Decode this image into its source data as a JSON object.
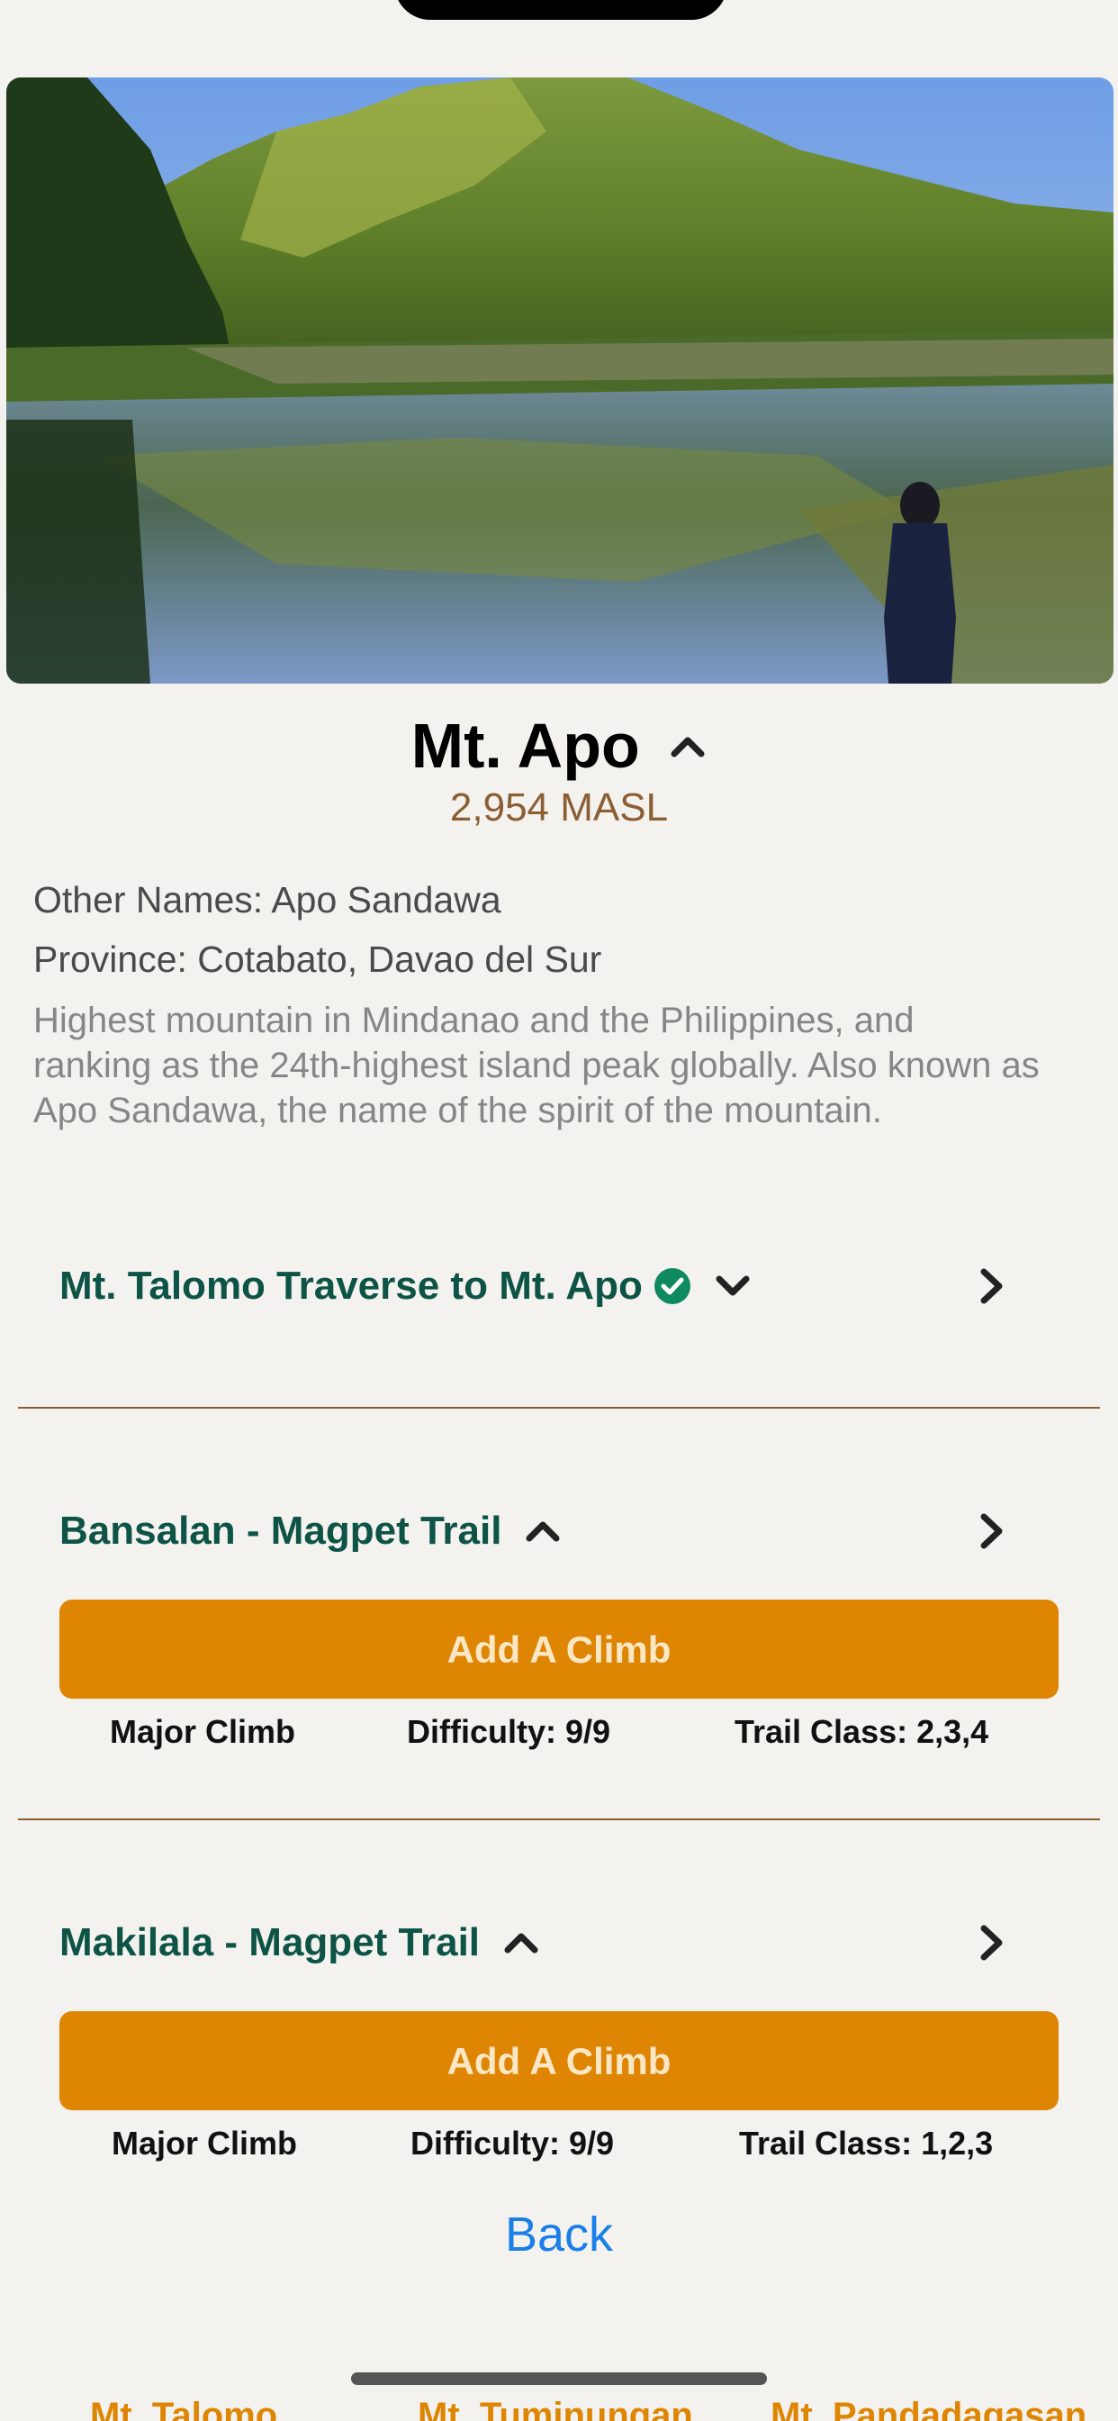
{
  "mountain": {
    "name": "Mt. Apo",
    "elevation": "2,954 MASL",
    "other_names": "Other Names: Apo Sandawa",
    "province": "Province: Cotabato, Davao del Sur",
    "description": "Highest mountain in Mindanao and the Philippines, and ranking as the 24th-highest island peak globally. Also known as Apo Sandawa, the name of the spirit of the mountain."
  },
  "trails": [
    {
      "name": "Mt. Talomo Traverse to Mt. Apo",
      "completed": true,
      "expanded": false
    },
    {
      "name": "Bansalan - Magpet Trail",
      "expanded": true,
      "button_label": "Add A Climb",
      "type": "Major Climb",
      "difficulty": "Difficulty: 9/9",
      "trail_class": "Trail Class: 2,3,4"
    },
    {
      "name": "Makilala - Magpet Trail",
      "expanded": true,
      "button_label": "Add A Climb",
      "type": "Major Climb",
      "difficulty": "Difficulty: 9/9",
      "trail_class": "Trail Class: 1,2,3"
    }
  ],
  "back_label": "Back",
  "bottom_tabs": [
    "Mt. Talomo",
    "Mt. Tuminungan",
    "Mt. Pandadagasan"
  ],
  "colors": {
    "accent": "#de8603",
    "trail_name": "#0d5446",
    "elevation": "#8b5e34",
    "link": "#1a7fe6",
    "check": "#0f8a5f"
  }
}
